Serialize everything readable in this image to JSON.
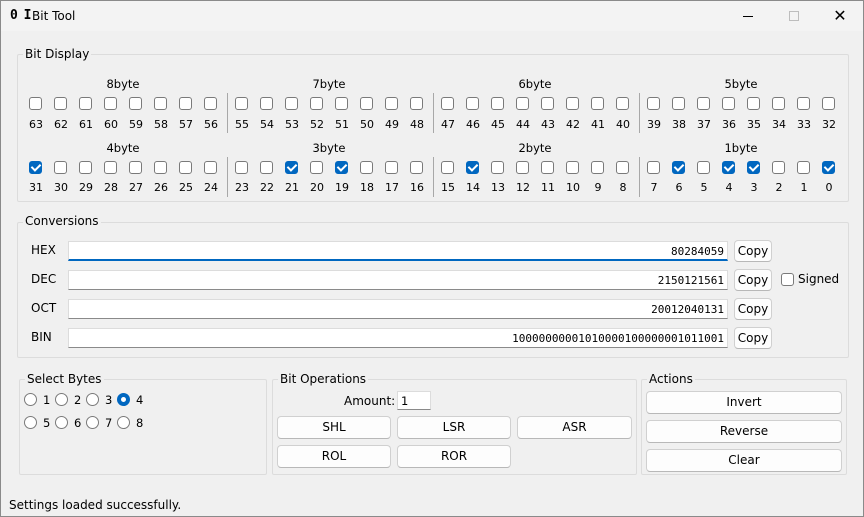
{
  "window": {
    "icon_text": "0 I",
    "title": "Bit Tool",
    "minimize": "—",
    "maximize": "",
    "close": "✕"
  },
  "bit_display": {
    "label": "Bit Display",
    "rows": [
      {
        "bytes": [
          {
            "name": "8byte",
            "bits": [
              {
                "n": "63",
                "c": false
              },
              {
                "n": "62",
                "c": false
              },
              {
                "n": "61",
                "c": false
              },
              {
                "n": "60",
                "c": false
              },
              {
                "n": "59",
                "c": false
              },
              {
                "n": "58",
                "c": false
              },
              {
                "n": "57",
                "c": false
              },
              {
                "n": "56",
                "c": false
              }
            ]
          },
          {
            "name": "7byte",
            "bits": [
              {
                "n": "55",
                "c": false
              },
              {
                "n": "54",
                "c": false
              },
              {
                "n": "53",
                "c": false
              },
              {
                "n": "52",
                "c": false
              },
              {
                "n": "51",
                "c": false
              },
              {
                "n": "50",
                "c": false
              },
              {
                "n": "49",
                "c": false
              },
              {
                "n": "48",
                "c": false
              }
            ]
          },
          {
            "name": "6byte",
            "bits": [
              {
                "n": "47",
                "c": false
              },
              {
                "n": "46",
                "c": false
              },
              {
                "n": "45",
                "c": false
              },
              {
                "n": "44",
                "c": false
              },
              {
                "n": "43",
                "c": false
              },
              {
                "n": "42",
                "c": false
              },
              {
                "n": "41",
                "c": false
              },
              {
                "n": "40",
                "c": false
              }
            ]
          },
          {
            "name": "5byte",
            "bits": [
              {
                "n": "39",
                "c": false
              },
              {
                "n": "38",
                "c": false
              },
              {
                "n": "37",
                "c": false
              },
              {
                "n": "36",
                "c": false
              },
              {
                "n": "35",
                "c": false
              },
              {
                "n": "34",
                "c": false
              },
              {
                "n": "33",
                "c": false
              },
              {
                "n": "32",
                "c": false
              }
            ]
          }
        ]
      },
      {
        "bytes": [
          {
            "name": "4byte",
            "bits": [
              {
                "n": "31",
                "c": true
              },
              {
                "n": "30",
                "c": false
              },
              {
                "n": "29",
                "c": false
              },
              {
                "n": "28",
                "c": false
              },
              {
                "n": "27",
                "c": false
              },
              {
                "n": "26",
                "c": false
              },
              {
                "n": "25",
                "c": false
              },
              {
                "n": "24",
                "c": false
              }
            ]
          },
          {
            "name": "3byte",
            "bits": [
              {
                "n": "23",
                "c": false
              },
              {
                "n": "22",
                "c": false
              },
              {
                "n": "21",
                "c": true
              },
              {
                "n": "20",
                "c": false
              },
              {
                "n": "19",
                "c": true
              },
              {
                "n": "18",
                "c": false
              },
              {
                "n": "17",
                "c": false
              },
              {
                "n": "16",
                "c": false
              }
            ]
          },
          {
            "name": "2byte",
            "bits": [
              {
                "n": "15",
                "c": false
              },
              {
                "n": "14",
                "c": true
              },
              {
                "n": "13",
                "c": false
              },
              {
                "n": "12",
                "c": false
              },
              {
                "n": "11",
                "c": false
              },
              {
                "n": "10",
                "c": false
              },
              {
                "n": "9",
                "c": false
              },
              {
                "n": "8",
                "c": false
              }
            ]
          },
          {
            "name": "1byte",
            "bits": [
              {
                "n": "7",
                "c": false
              },
              {
                "n": "6",
                "c": true
              },
              {
                "n": "5",
                "c": false
              },
              {
                "n": "4",
                "c": true
              },
              {
                "n": "3",
                "c": true
              },
              {
                "n": "2",
                "c": false
              },
              {
                "n": "1",
                "c": false
              },
              {
                "n": "0",
                "c": true
              }
            ]
          }
        ]
      }
    ]
  },
  "conversions": {
    "label": "Conversions",
    "rows": [
      {
        "label": "HEX",
        "value": "80284059",
        "copy": "Copy"
      },
      {
        "label": "DEC",
        "value": "2150121561",
        "copy": "Copy"
      },
      {
        "label": "OCT",
        "value": "20012040131",
        "copy": "Copy"
      },
      {
        "label": "BIN",
        "value": "10000000001010000100000001011001",
        "copy": "Copy"
      }
    ],
    "signed_label": "Signed",
    "signed_checked": false
  },
  "select_bytes": {
    "label": "Select Bytes",
    "options": [
      "1",
      "2",
      "3",
      "4",
      "5",
      "6",
      "7",
      "8"
    ],
    "selected": "4"
  },
  "bit_operations": {
    "label": "Bit Operations",
    "amount_label": "Amount:",
    "amount_value": "1",
    "buttons": [
      "SHL",
      "LSR",
      "ASR",
      "ROL",
      "ROR"
    ]
  },
  "actions": {
    "label": "Actions",
    "buttons": [
      "Invert",
      "Reverse",
      "Clear"
    ]
  },
  "status": "Settings loaded successfully.",
  "colors": {
    "accent": "#0067c0",
    "background": "#f0f0f0"
  }
}
